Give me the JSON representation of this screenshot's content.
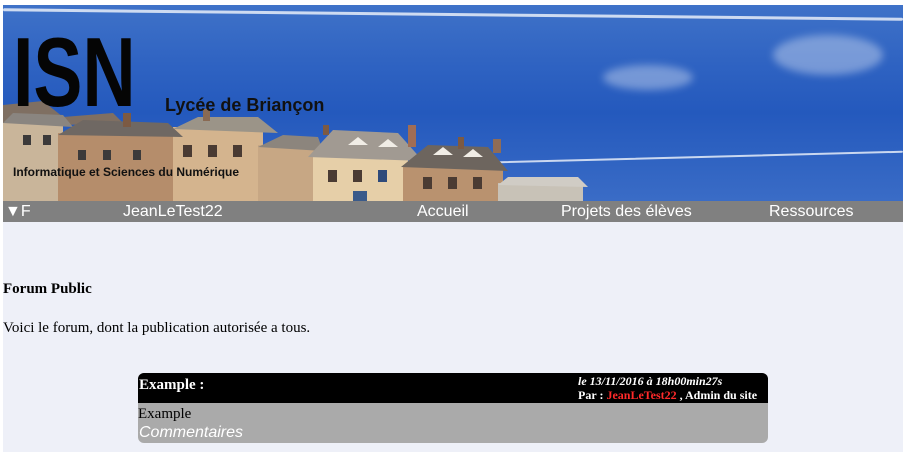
{
  "header": {
    "logo_text": "ISN",
    "school_name": "Lycée de Briançon",
    "subtitle": "Informatique et Sciences du Numérique"
  },
  "nav": {
    "menu_toggle": "▼F",
    "user": "JeanLeTest22",
    "items": [
      "Accueil",
      "Projets des élèves",
      "Ressources"
    ]
  },
  "forum": {
    "title": "Forum Public",
    "description": "Voici le forum, dont la publication autorisée a tous."
  },
  "posts": [
    {
      "title": "Example :",
      "date": "le 13/11/2016 à 18h00min27s",
      "by_prefix": "Par :",
      "author": "JeanLeTest22",
      "role": ", Admin du site",
      "body": "Example",
      "comments_label": "Commentaires"
    }
  ],
  "colors": {
    "navbar": "#808080",
    "page_background": "#eef0f8",
    "post_header": "#000000",
    "post_body": "#aaaaaa",
    "author_highlight": "#ff2a2a"
  }
}
